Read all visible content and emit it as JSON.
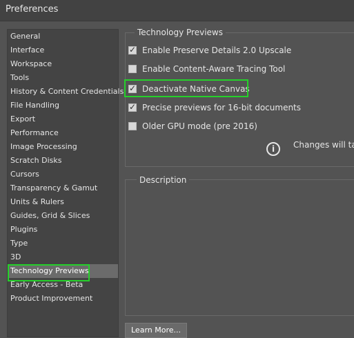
{
  "window": {
    "title": "Preferences"
  },
  "sidebar": {
    "items": [
      {
        "label": "General",
        "active": false
      },
      {
        "label": "Interface",
        "active": false
      },
      {
        "label": "Workspace",
        "active": false
      },
      {
        "label": "Tools",
        "active": false
      },
      {
        "label": "History & Content Credentials",
        "active": false
      },
      {
        "label": "File Handling",
        "active": false
      },
      {
        "label": "Export",
        "active": false
      },
      {
        "label": "Performance",
        "active": false
      },
      {
        "label": "Image Processing",
        "active": false
      },
      {
        "label": "Scratch Disks",
        "active": false
      },
      {
        "label": "Cursors",
        "active": false
      },
      {
        "label": "Transparency & Gamut",
        "active": false
      },
      {
        "label": "Units & Rulers",
        "active": false
      },
      {
        "label": "Guides, Grid & Slices",
        "active": false
      },
      {
        "label": "Plugins",
        "active": false
      },
      {
        "label": "Type",
        "active": false
      },
      {
        "label": "3D",
        "active": false
      },
      {
        "label": "Technology Previews",
        "active": true
      },
      {
        "label": "Early Access - Beta",
        "active": false
      },
      {
        "label": "Product Improvement",
        "active": false
      }
    ]
  },
  "tech_previews": {
    "group_title": "Technology Previews",
    "options": [
      {
        "label": "Enable Preserve Details 2.0 Upscale",
        "checked": true
      },
      {
        "label": "Enable Content-Aware Tracing Tool",
        "checked": false
      },
      {
        "label": "Deactivate Native Canvas",
        "checked": true,
        "highlighted": true
      },
      {
        "label": "Precise previews for 16-bit documents",
        "checked": true
      },
      {
        "label": "Older GPU mode (pre 2016)",
        "checked": false
      }
    ],
    "info_text": "Changes will tak"
  },
  "description": {
    "title": "Description"
  },
  "bottom_button": {
    "label": "Learn More..."
  },
  "colors": {
    "background": "#535353",
    "titlebar": "#424242",
    "highlight_green": "#25d12a",
    "sidebar_active": "#6b6b6b"
  }
}
